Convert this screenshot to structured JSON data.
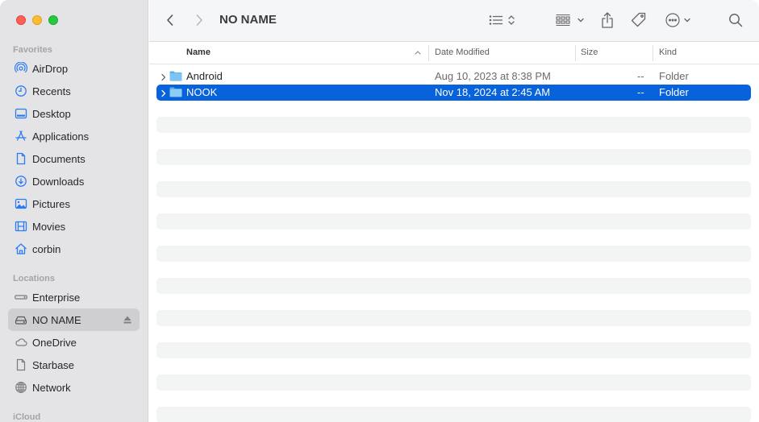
{
  "window": {
    "title": "NO NAME",
    "accent_color": "#0862dc"
  },
  "sidebar": {
    "sections": [
      {
        "label": "Favorites",
        "items": [
          {
            "label": "AirDrop",
            "icon": "airdrop-icon"
          },
          {
            "label": "Recents",
            "icon": "clock-icon"
          },
          {
            "label": "Desktop",
            "icon": "desktop-icon"
          },
          {
            "label": "Applications",
            "icon": "applications-icon"
          },
          {
            "label": "Documents",
            "icon": "document-icon"
          },
          {
            "label": "Downloads",
            "icon": "download-icon"
          },
          {
            "label": "Pictures",
            "icon": "photo-icon"
          },
          {
            "label": "Movies",
            "icon": "film-icon"
          },
          {
            "label": "corbin",
            "icon": "home-icon"
          }
        ]
      },
      {
        "label": "Locations",
        "items": [
          {
            "label": "Enterprise",
            "icon": "external-drive-icon"
          },
          {
            "label": "NO NAME",
            "icon": "drive-icon",
            "selected": true,
            "eject": true
          },
          {
            "label": "OneDrive",
            "icon": "cloud-icon"
          },
          {
            "label": "Starbase",
            "icon": "document-icon"
          },
          {
            "label": "Network",
            "icon": "globe-icon"
          }
        ]
      },
      {
        "label": "iCloud",
        "items": []
      }
    ]
  },
  "toolbar": {
    "back": "chevron-left-icon",
    "forward": "chevron-right-icon",
    "view_mode": "list-view-icon",
    "group": "group-icon",
    "share": "share-icon",
    "tag": "tag-icon",
    "more": "ellipsis-circle-icon",
    "search": "search-icon"
  },
  "columns": {
    "name": "Name",
    "date_modified": "Date Modified",
    "size": "Size",
    "kind": "Kind",
    "sort": "ascending"
  },
  "files": [
    {
      "name": "Android",
      "date_modified": "Aug 10, 2023 at 8:38 PM",
      "size": "--",
      "kind": "Folder",
      "selected": false
    },
    {
      "name": "NOOK",
      "date_modified": "Nov 18, 2024 at 2:45 AM",
      "size": "--",
      "kind": "Folder",
      "selected": true
    }
  ]
}
